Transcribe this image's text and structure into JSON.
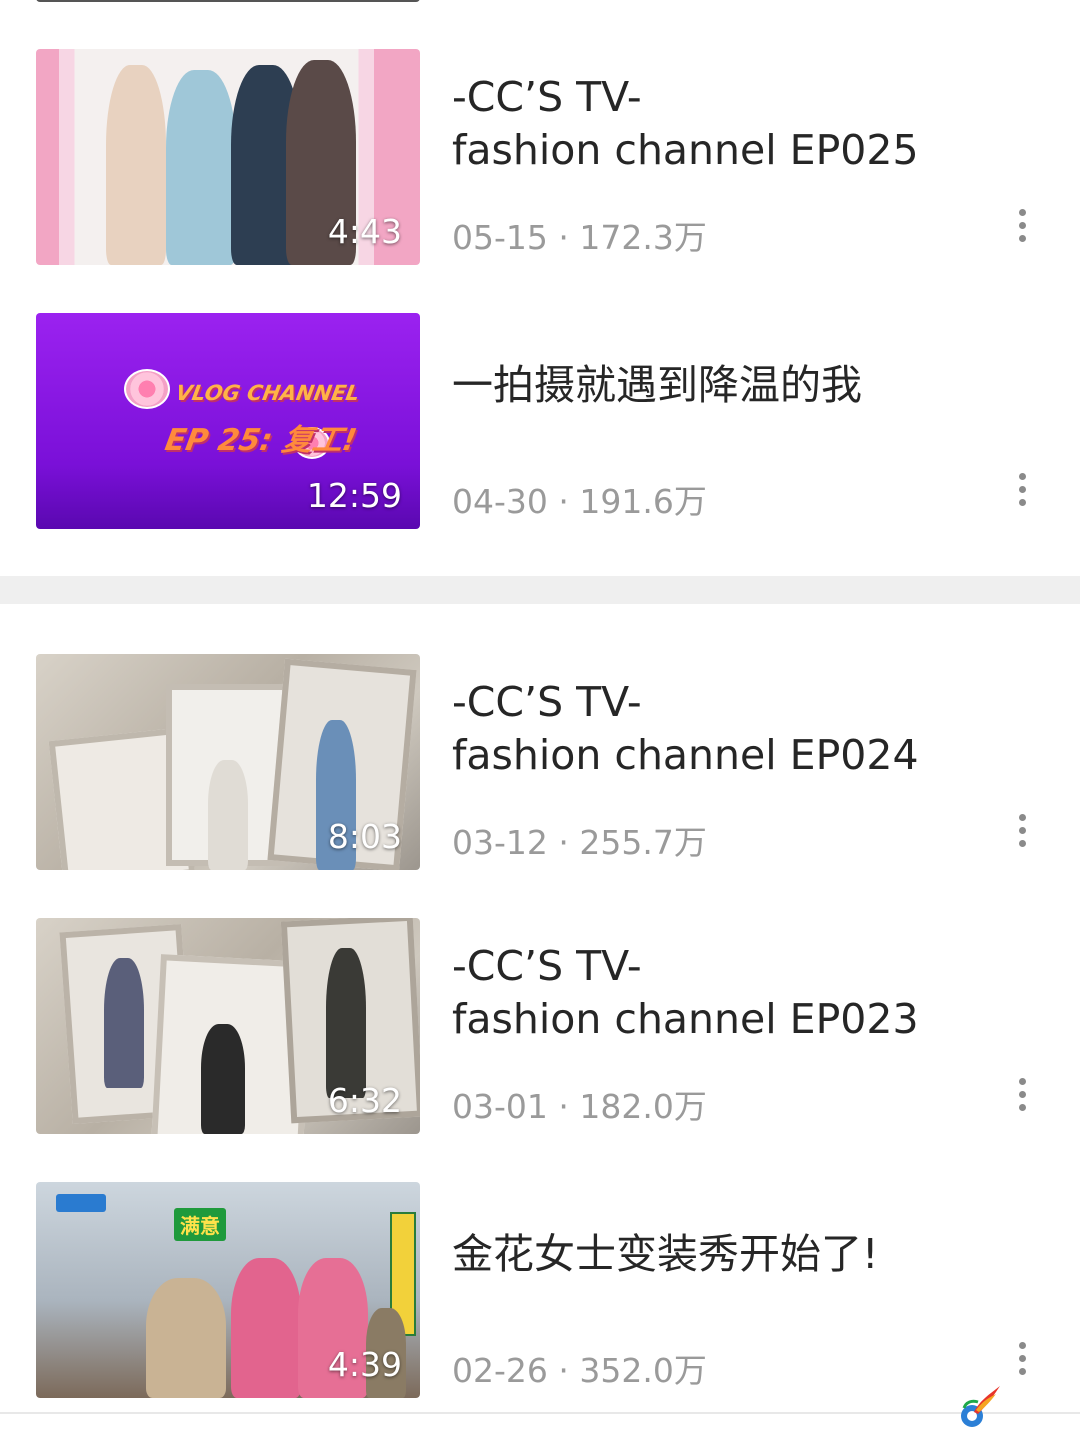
{
  "videos": [
    {
      "title": "-CC’S TV-\nfashion channel EP025",
      "date": "05-15",
      "views": "172.3万",
      "meta": "05-15 · 172.3万",
      "duration": "4:43"
    },
    {
      "title": "一拍摄就遇到降温的我",
      "date": "04-30",
      "views": "191.6万",
      "meta": "04-30 · 191.6万",
      "duration": "12:59",
      "thumb_text": {
        "line1": "VLOG CHANNEL",
        "line2": "EP 25: 复工!"
      }
    },
    {
      "title": "-CC’S TV-\nfashion channel EP024",
      "date": "03-12",
      "views": "255.7万",
      "meta": "03-12 · 255.7万",
      "duration": "8:03"
    },
    {
      "title": "-CC’S TV-\nfashion channel EP023",
      "date": "03-01",
      "views": "182.0万",
      "meta": "03-01 · 182.0万",
      "duration": "6:32"
    },
    {
      "title": "金花女士变装秀开始了!",
      "date": "02-26",
      "views": "352.0万",
      "meta": "02-26 · 352.0万",
      "duration": "4:39",
      "thumb_text": {
        "badge": "满意"
      }
    }
  ],
  "colors": {
    "divider": "#efefef",
    "meta_text": "#9a9a9a",
    "title_text": "#262626",
    "purple_thumb": "#8a16e6"
  },
  "icons": {
    "more": "more-vertical-icon",
    "watermark": "watermark-logo-icon"
  }
}
